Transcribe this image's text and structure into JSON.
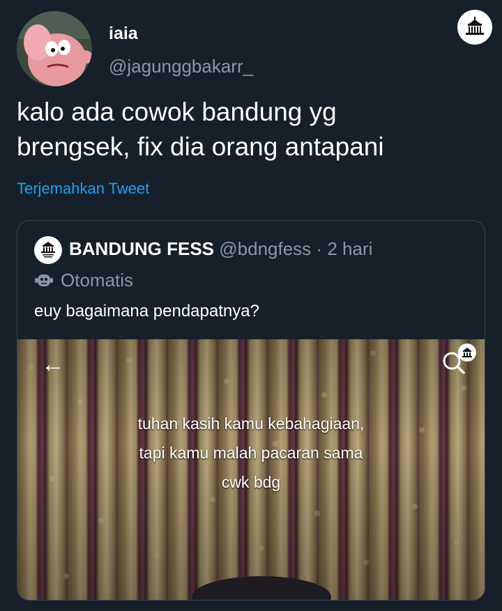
{
  "tweet": {
    "display_name": "iaia",
    "handle": "@jagunggbakarr_",
    "text": "kalo ada cowok bandung yg\nbrengsek, fix dia orang antapani",
    "translate_label": "Terjemahkan Tweet"
  },
  "quoted": {
    "display_name": "BANDUNG FESS",
    "handle": "@bdngfess",
    "separator": "·",
    "time": "2 hari",
    "automated_label": "Otomatis",
    "text": "euy bagaimana pendapatnya?",
    "media_caption": "tuhan kasih kamu kebahagiaan,\ntapi kamu malah pacaran sama\ncwk bdg",
    "avatar_text": "BANDUNG FESS"
  },
  "colors": {
    "background": "#15202b",
    "link": "#1da1f2",
    "secondary_text": "#8899a6",
    "border": "#38444d"
  },
  "icons": {
    "badge": "gedung-sate-icon",
    "back": "back-arrow-icon",
    "search": "search-icon",
    "bot": "bot-icon"
  }
}
